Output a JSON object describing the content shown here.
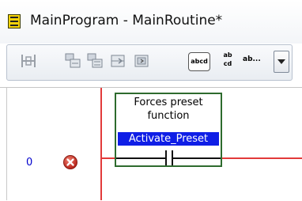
{
  "window": {
    "title": "MainProgram - MainRoutine*",
    "icon": "ladder-routine-icon"
  },
  "toolbar": {
    "buttons": [
      {
        "icon": "add-rung-icon"
      },
      {
        "icon": "add-branch-icon"
      },
      {
        "icon": "add-branch-level-icon"
      },
      {
        "icon": "add-contact-icon"
      },
      {
        "icon": "add-coil-icon"
      }
    ],
    "abcd_label": "abcd",
    "ab_cd_top": "ab",
    "ab_cd_bottom": "cd",
    "ab_more_label": "ab..."
  },
  "ladder": {
    "rung_number": "0",
    "rung_status": "error",
    "rung_status_icon": "error-x-icon",
    "wire_color": "#e23a3a",
    "instruction": {
      "type": "XIC",
      "description_line1": "Forces preset",
      "description_line2": "function",
      "tag": "Activate_Preset",
      "border_color": "#2e6b2e",
      "tag_highlight_color": "#0f1ee6"
    }
  }
}
